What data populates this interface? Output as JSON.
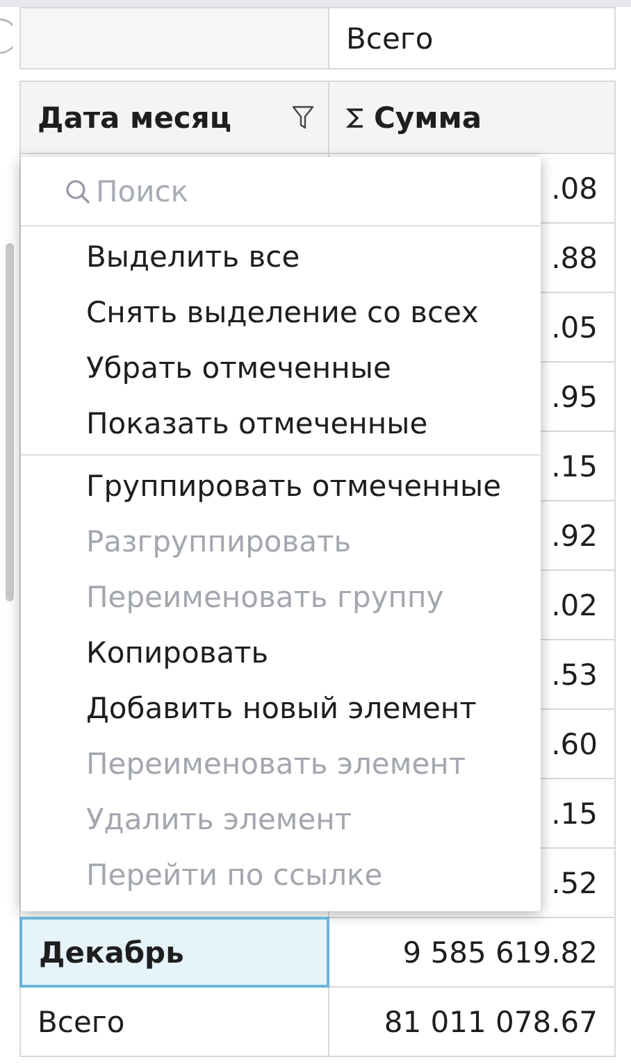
{
  "top_row": {
    "column_2": "Всего"
  },
  "header": [
    {
      "label": "Дата месяц",
      "filter": true
    },
    {
      "label": "Сумма",
      "sum": true
    }
  ],
  "rows": [
    {
      "value": ".08"
    },
    {
      "value": ".88"
    },
    {
      "value": ".05"
    },
    {
      "value": ".95"
    },
    {
      "value": ".15"
    },
    {
      "value": ".92"
    },
    {
      "value": ".02"
    },
    {
      "value": ".53"
    },
    {
      "value": ".60"
    },
    {
      "value": ".15"
    },
    {
      "value": ".52"
    },
    {
      "label": "Декабрь",
      "value": "9 585 619.82",
      "selected": true,
      "bold": true
    },
    {
      "label": "Всего",
      "value": "81 011 078.67",
      "selected": false,
      "bold": false
    }
  ],
  "filter_menu": {
    "search": {
      "placeholder": "Поиск"
    },
    "sections": [
      [
        {
          "label": "Выделить все",
          "disabled": false
        },
        {
          "label": "Снять выделение со всех",
          "disabled": false
        },
        {
          "label": "Убрать отмеченные",
          "disabled": false
        },
        {
          "label": "Показать отмеченные",
          "disabled": false
        }
      ],
      [
        {
          "label": "Группировать отмеченные",
          "disabled": false
        },
        {
          "label": "Разгруппировать",
          "disabled": true
        },
        {
          "label": "Переименовать группу",
          "disabled": true
        },
        {
          "label": "Копировать",
          "disabled": false
        },
        {
          "label": "Добавить новый элемент",
          "disabled": false
        },
        {
          "label": "Переименовать элемент",
          "disabled": true
        },
        {
          "label": "Удалить элемент",
          "disabled": true
        },
        {
          "label": "Перейти по ссылке",
          "disabled": true
        }
      ]
    ]
  }
}
